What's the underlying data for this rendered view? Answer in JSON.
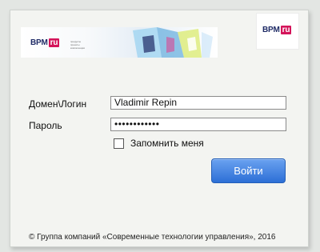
{
  "corner_logo": {
    "brand": "BPM",
    "tag": "ru"
  },
  "banner": {
    "brand": "BPM",
    "tag": "ru",
    "tagline": [
      "продукты",
      "проекты",
      "компетенции"
    ]
  },
  "form": {
    "login_label": "Домен\\Логин",
    "login_value": "Vladimir Repin",
    "password_label": "Пароль",
    "password_value": "••••••••••••",
    "remember_label": "Запомнить меня",
    "remember_checked": false,
    "submit_label": "Войти"
  },
  "footer": {
    "copyright": "© Группа компаний «Современные технологии управления», 2016"
  },
  "colors": {
    "brand_navy": "#1f2b66",
    "brand_magenta": "#d4145a",
    "button_blue": "#2d6fd6"
  }
}
